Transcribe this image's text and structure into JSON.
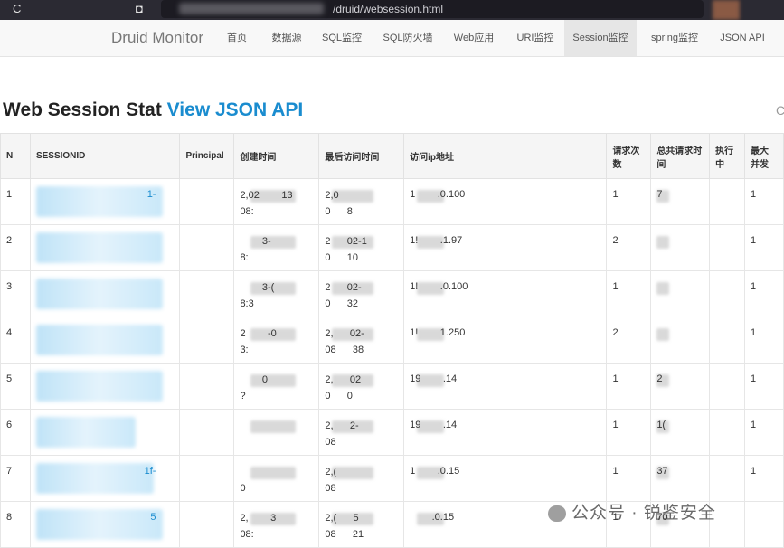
{
  "browser": {
    "url_suffix": "/druid/websession.html",
    "reload_glyph": "C",
    "bookmark_glyph": "◘"
  },
  "nav": {
    "brand": "Druid Monitor",
    "items": [
      "首页",
      "数据源",
      "SQL监控",
      "SQL防火墙",
      "Web应用",
      "URI监控",
      "Session监控",
      "spring监控",
      "JSON API"
    ],
    "active": "Session监控"
  },
  "page": {
    "title": "Web Session Stat",
    "json_link": "View JSON API",
    "edge_char": "C"
  },
  "table": {
    "headers": [
      "N",
      "SESSIONID",
      "Principal",
      "创建时间",
      "最后访问时间",
      "访问ip地址",
      "请求次数",
      "总共请求时间",
      "执行中",
      "最大并发"
    ],
    "rows": [
      {
        "n": "1",
        "sid_tail": "1-",
        "created": [
          "2,02",
          "13",
          "08:"
        ],
        "last": [
          "2,0",
          "",
          "0",
          "8"
        ],
        "ip": [
          "1",
          ".0.100"
        ],
        "count": "1",
        "total": "7",
        "running": "",
        "max": "1"
      },
      {
        "n": "2",
        "sid_tail": "",
        "created": [
          "",
          "3-",
          "8:"
        ],
        "last": [
          "2",
          "02-1",
          "0",
          "10"
        ],
        "ip": [
          "1!",
          ".1.97"
        ],
        "count": "2",
        "total": "",
        "running": "",
        "max": "1"
      },
      {
        "n": "3",
        "sid_tail": "",
        "created": [
          "",
          "3-(",
          "8:3"
        ],
        "last": [
          "2",
          "02-",
          "0",
          "32"
        ],
        "ip": [
          "1!",
          ".0.100"
        ],
        "count": "1",
        "total": "",
        "running": "",
        "max": "1"
      },
      {
        "n": "4",
        "sid_tail": "",
        "created": [
          "2",
          "-0",
          "3:"
        ],
        "last": [
          "2,",
          "02-",
          "08",
          "38"
        ],
        "ip": [
          "1!",
          "1.250"
        ],
        "count": "2",
        "total": "",
        "running": "",
        "max": "1"
      },
      {
        "n": "5",
        "sid_tail": "",
        "created": [
          "",
          "0",
          "?"
        ],
        "last": [
          "2,",
          "02",
          "0",
          "0"
        ],
        "ip": [
          "19",
          ".14"
        ],
        "count": "1",
        "total": "2",
        "running": "",
        "max": "1"
      },
      {
        "n": "6",
        "sid_tail": "",
        "created": [
          "",
          "",
          ""
        ],
        "last": [
          "2,",
          "2-",
          "08",
          ""
        ],
        "ip": [
          "19",
          ".14"
        ],
        "count": "1",
        "total": "1(",
        "running": "",
        "max": "1"
      },
      {
        "n": "7",
        "sid_tail": "1f-",
        "created": [
          "",
          "",
          "0"
        ],
        "last": [
          "2,(",
          "",
          "08",
          ""
        ],
        "ip": [
          "1",
          ".0.15"
        ],
        "count": "1",
        "total": "37",
        "running": "",
        "max": "1"
      },
      {
        "n": "8",
        "sid_tail": "5",
        "created": [
          "2,",
          "3",
          "08:"
        ],
        "last": [
          "2,(",
          "5",
          "08",
          "21"
        ],
        "ip": [
          "",
          ".0.15"
        ],
        "count": "1",
        "total": "70",
        "running": "",
        "max": ""
      }
    ]
  },
  "watermark": "公众号 · 锐鉴安全",
  "colors": {
    "link": "#1a8ccf",
    "header_bg": "#f5f5f5",
    "nav_active": "#e6e6e6"
  }
}
